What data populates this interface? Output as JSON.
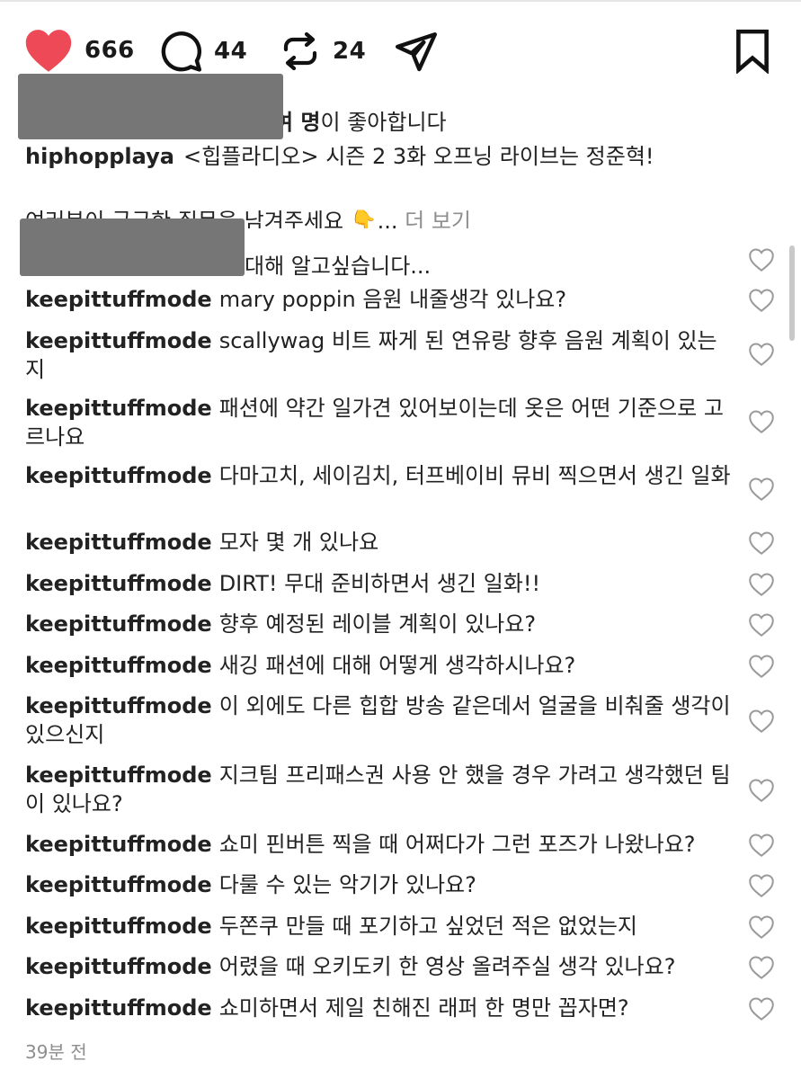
{
  "actions": {
    "likes": "666",
    "comments": "44",
    "reposts": "24",
    "like_color": "#ed4956"
  },
  "likes_line": {
    "suffix_bold": "여 명",
    "suffix_rest": "이 좋아합니다"
  },
  "caption": {
    "username": "hiphopplaya",
    "text": "<힙플라디오> 시즌 2 3화 오프닝 라이브는 정준혁!",
    "line2": "여러분이 궁금한 질문을 남겨주세요 👇...",
    "more_label": "더 보기"
  },
  "first_comment_text": "대해 알고싶습니다...",
  "comments": [
    {
      "user": "keepittuffmode",
      "text": "mary poppin 음원 내줄생각 있나요?"
    },
    {
      "user": "keepittuffmode",
      "text": "scallywag 비트 짜게 된 연유랑 향후 음원 계획이 있는지"
    },
    {
      "user": "keepittuffmode",
      "text": "패션에 약간 일가견 있어보이는데 옷은 어떤 기준으로 고르나요"
    },
    {
      "user": "keepittuffmode",
      "text": "다마고치, 세이김치, 터프베이비 뮤비 찍으면서 생긴 일화"
    },
    {
      "user": "keepittuffmode",
      "text": "모자 몇 개 있나요"
    },
    {
      "user": "keepittuffmode",
      "text": "DIRT! 무대 준비하면서 생긴 일화!!"
    },
    {
      "user": "keepittuffmode",
      "text": "향후 예정된 레이블 계획이 있나요?"
    },
    {
      "user": "keepittuffmode",
      "text": "새깅 패션에 대해 어떻게 생각하시나요?"
    },
    {
      "user": "keepittuffmode",
      "text": "이 외에도 다른 힙합 방송 같은데서 얼굴을 비춰줄 생각이 있으신지"
    },
    {
      "user": "keepittuffmode",
      "text": "지크팀 프리패스권 사용 안 했을 경우 가려고 생각했던 팀이 있나요?"
    },
    {
      "user": "keepittuffmode",
      "text": "쇼미 핀버튼 찍을 때 어쩌다가 그런 포즈가 나왔나요?"
    },
    {
      "user": "keepittuffmode",
      "text": "다룰 수 있는 악기가 있나요?"
    },
    {
      "user": "keepittuffmode",
      "text": "두쫀쿠 만들 때 포기하고 싶었던 적은 없었는지"
    },
    {
      "user": "keepittuffmode",
      "text": "어렸을 때 오키도키 한 영상 올려주실 생각 있나요?"
    },
    {
      "user": "keepittuffmode",
      "text": "쇼미하면서 제일 친해진 래퍼 한 명만 꼽자면?"
    }
  ],
  "timestamp": "39분 전"
}
